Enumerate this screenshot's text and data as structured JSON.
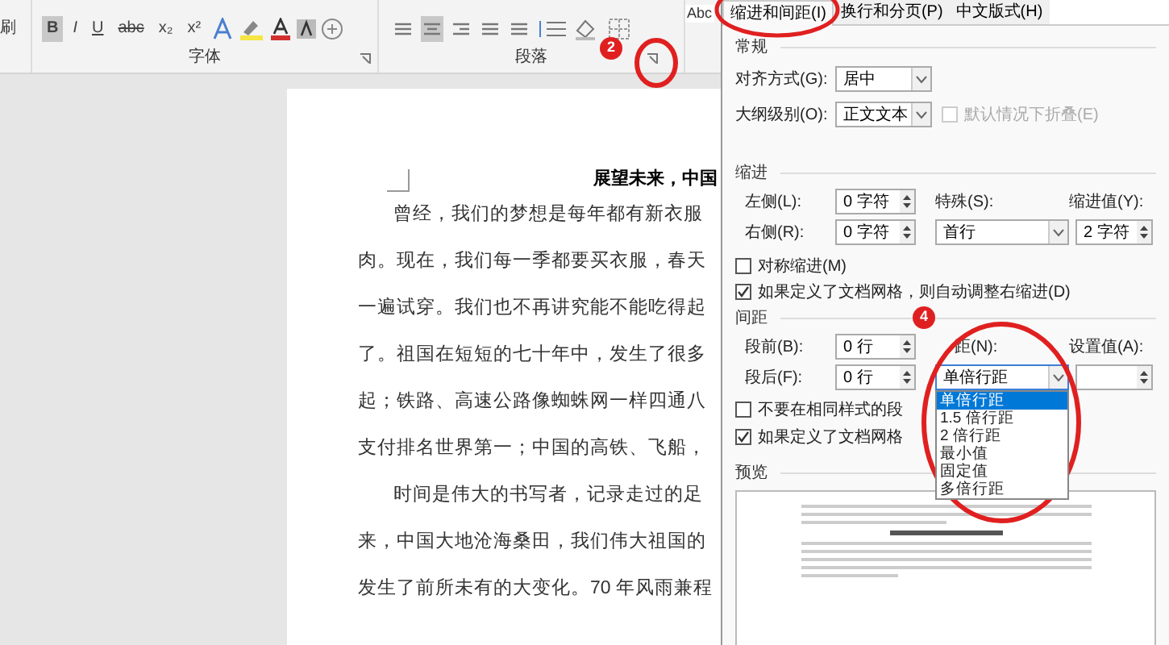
{
  "ribbon": {
    "clipboard_label": "刷",
    "styles_preview": "Abc",
    "font_group": {
      "label": "字体",
      "buttons": [
        {
          "label": "B",
          "selected": true
        },
        {
          "label": "I",
          "selected": false
        },
        {
          "label": "U",
          "selected": false
        },
        {
          "label": "abc",
          "selected": false
        },
        {
          "label": "x₂",
          "selected": false
        },
        {
          "label": "x²",
          "selected": false
        }
      ]
    },
    "paragraph_group": {
      "label": "段落",
      "align_buttons": [
        {
          "selected": false
        },
        {
          "selected": true
        },
        {
          "selected": false
        },
        {
          "selected": false
        },
        {
          "selected": false
        }
      ]
    }
  },
  "document": {
    "title": "展望未来，中国",
    "paragraphs": [
      {
        "lines": [
          "曾经，我们的梦想是每年都有新衣服",
          "肉。现在，我们每一季都要买衣服，春天",
          "一遍试穿。我们也不再讲究能不能吃得起",
          "了。祖国在短短的七十年中，发生了很多",
          "起；铁路、高速公路像蜘蛛网一样四通八",
          "支付排名世界第一；中国的高铁、飞船，"
        ]
      },
      {
        "lines": [
          "时间是伟大的书写者，记录走过的足",
          "来，中国大地沧海桑田，我们伟大祖国的",
          "发生了前所未有的大变化。70 年风雨兼程"
        ]
      }
    ]
  },
  "dialog": {
    "tabs": [
      {
        "label": "缩进和间距(I)",
        "selected": true
      },
      {
        "label": "换行和分页(P)",
        "selected": false
      },
      {
        "label": "中文版式(H)",
        "selected": false
      }
    ],
    "general": {
      "heading": "常规",
      "alignment_label": "对齐方式(G):",
      "alignment": "居中",
      "outline_label": "大纲级别(O):",
      "outline": "正文文本",
      "collapse": {
        "label": "默认情况下折叠(E)",
        "checked": false,
        "disabled": true
      }
    },
    "indent": {
      "heading": "缩进",
      "left_label": "左侧(L):",
      "left": "0 字符",
      "right_label": "右侧(R):",
      "right": "0 字符",
      "special_label": "特殊(S):",
      "special": "首行",
      "by_label": "缩进值(Y):",
      "by": "2 字符",
      "checkboxes": [
        {
          "label": "对称缩进(M)",
          "checked": false
        },
        {
          "label": "如果定义了文档网格，则自动调整右缩进(D)",
          "checked": true
        }
      ]
    },
    "spacing": {
      "heading": "间距",
      "before_label": "段前(B):",
      "before": "0 行",
      "after_label": "段后(F):",
      "after": "0 行",
      "line_label": "距(N):",
      "line": "单倍行距",
      "at_label": "设置值(A):",
      "line_options": [
        {
          "label": "单倍行距",
          "selected": true
        },
        {
          "label": "1.5 倍行距",
          "selected": false
        },
        {
          "label": "2 倍行距",
          "selected": false
        },
        {
          "label": "最小值",
          "selected": false
        },
        {
          "label": "固定值",
          "selected": false
        },
        {
          "label": "多倍行距",
          "selected": false
        }
      ],
      "checkboxes": [
        {
          "label": "不要在相同样式的段",
          "checked": false
        },
        {
          "label": "如果定义了文档网格",
          "checked": true
        }
      ]
    },
    "preview": {
      "heading": "预览"
    }
  },
  "annotations": [
    {
      "label": "2"
    },
    {
      "label": "4"
    }
  ]
}
